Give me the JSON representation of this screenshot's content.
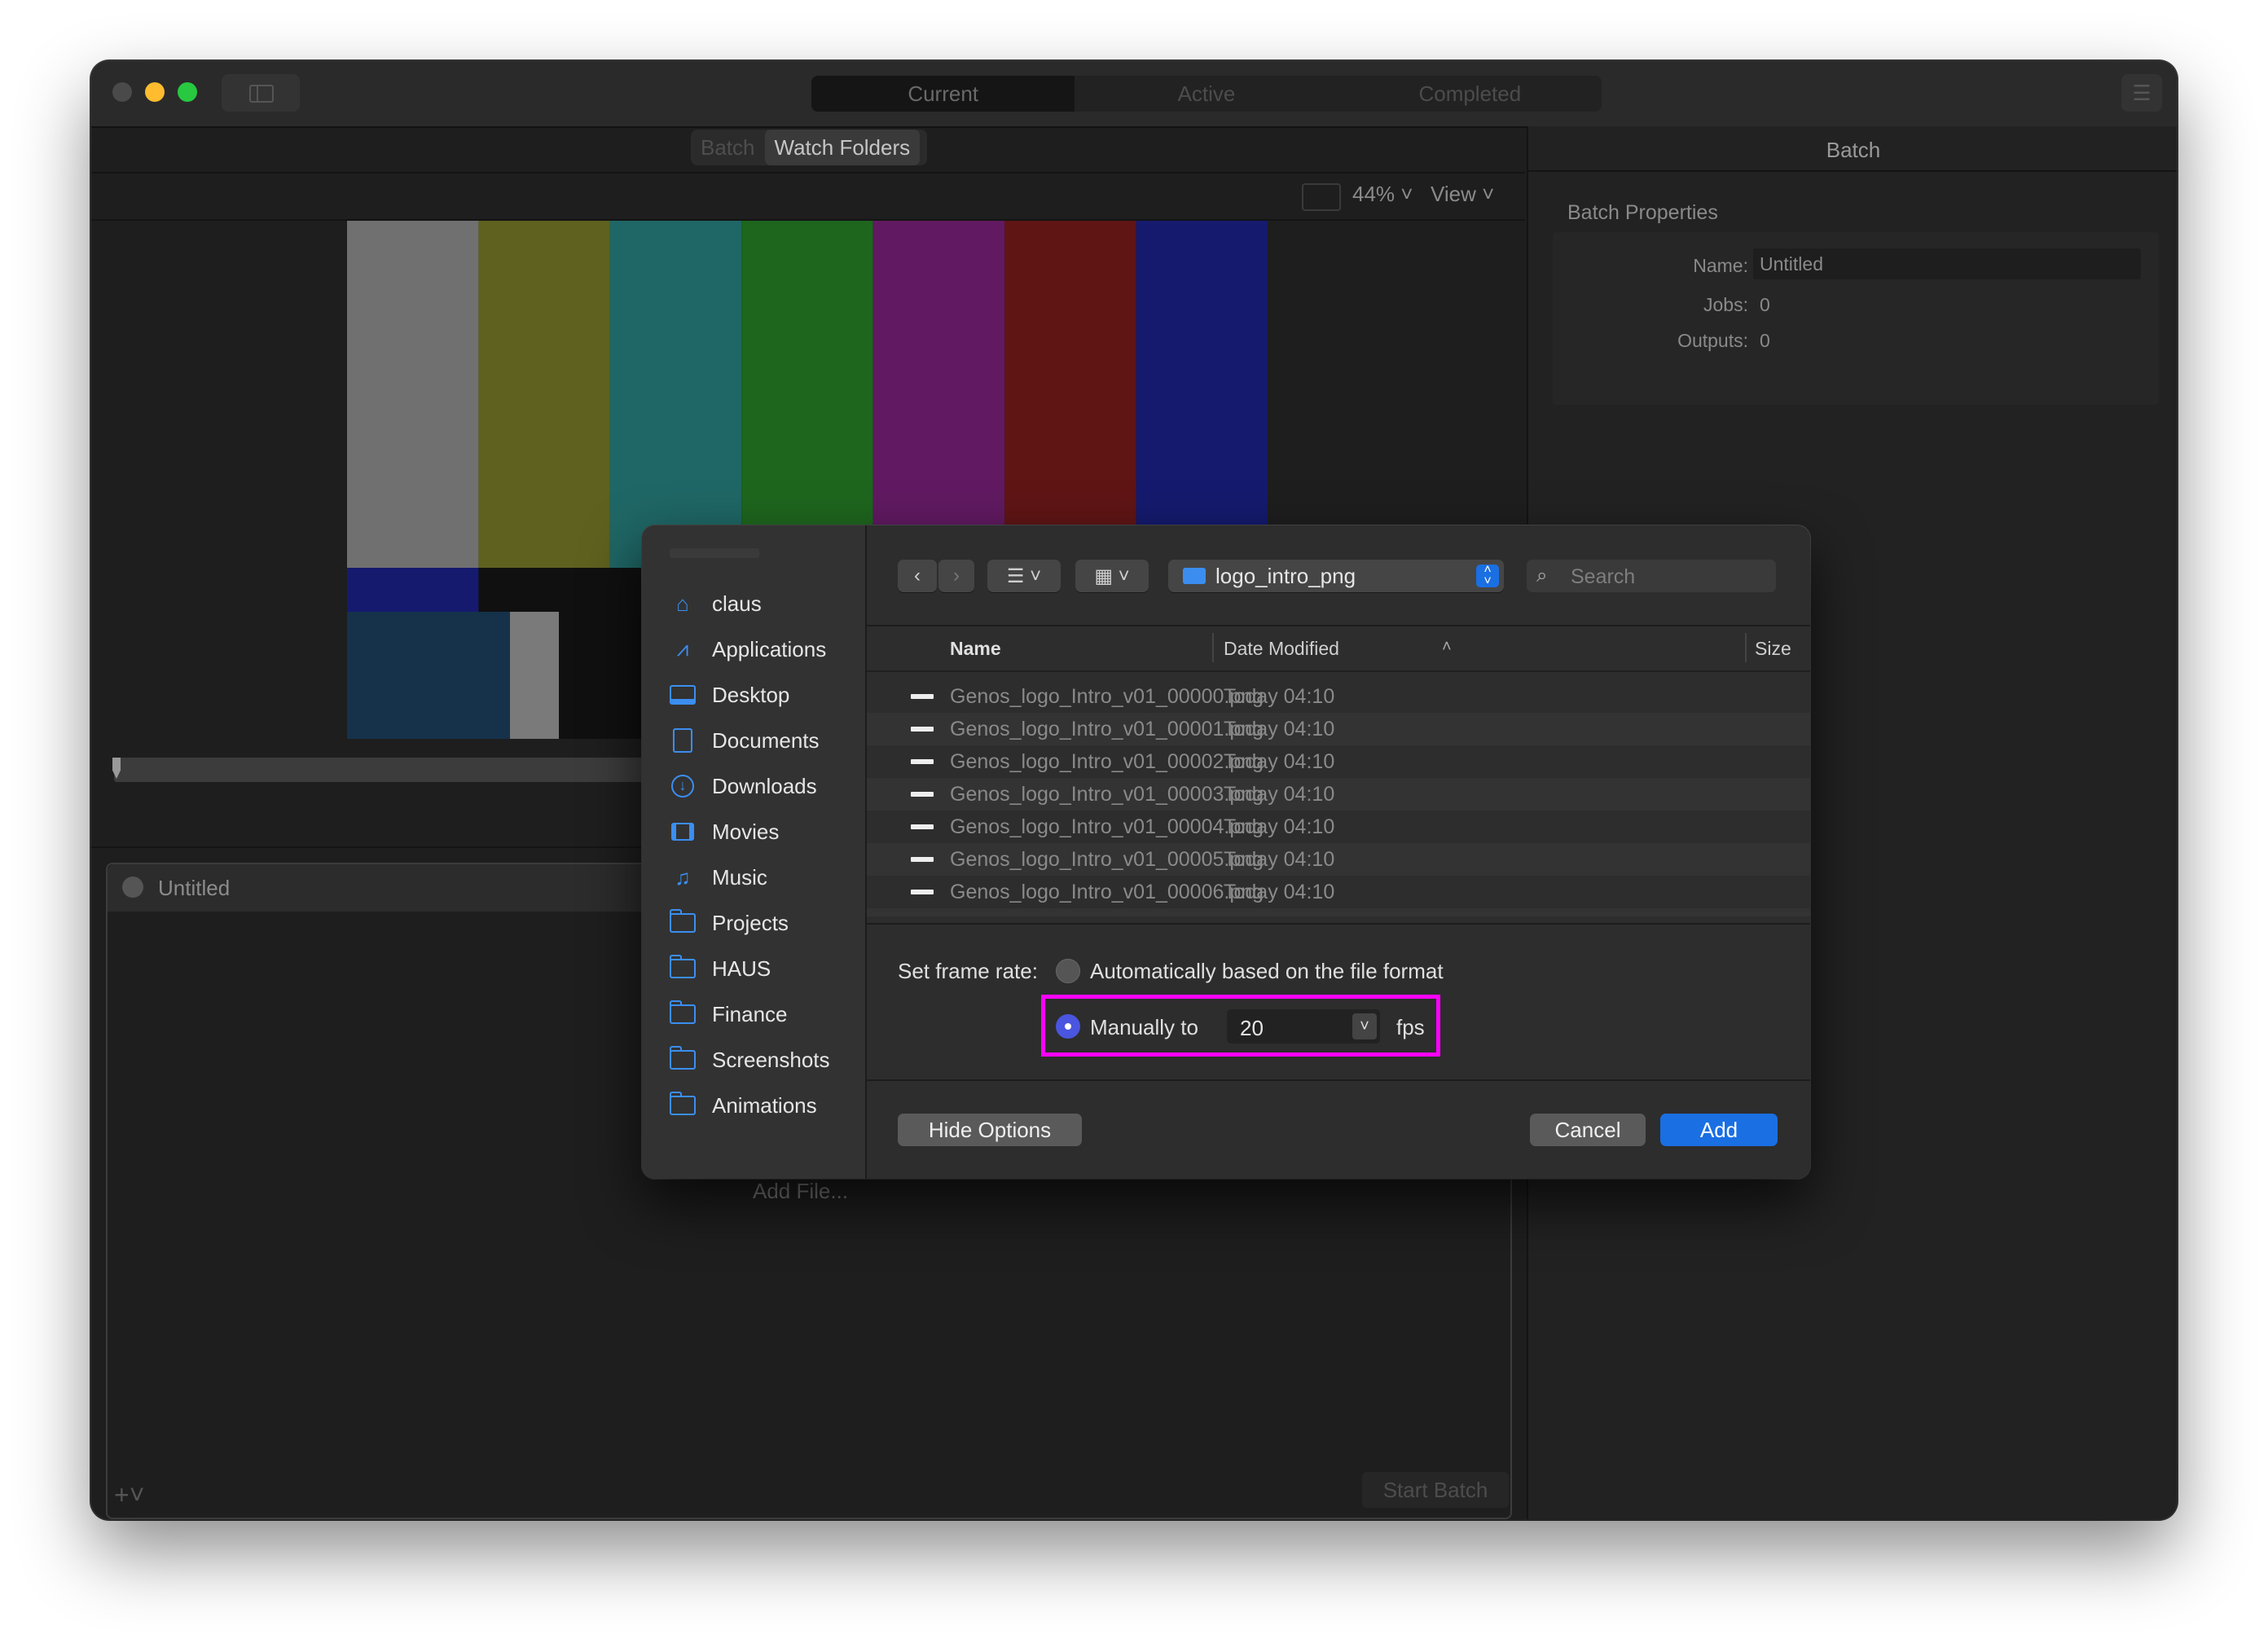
{
  "window": {
    "segments": [
      "Current",
      "Active",
      "Completed"
    ],
    "selected_segment": "Current",
    "subtabs": [
      "Batch",
      "Watch Folders"
    ],
    "selected_subtab": "Watch Folders",
    "zoom": "44%",
    "view_label": "View",
    "job_title": "Untitled",
    "add_file_label": "Add File...",
    "start_batch_label": "Start Batch"
  },
  "colors": {
    "close": "#ff5f57",
    "minimize": "#febc2e",
    "zoom": "#28c840",
    "accent": "#1a6fe3",
    "highlight_border": "#ff00ff",
    "colorbars": [
      "#707070",
      "#5f611f",
      "#1f6766",
      "#1e661e",
      "#611a61",
      "#601515",
      "#151a6e"
    ]
  },
  "inspector": {
    "header": "Batch",
    "section": "Batch Properties",
    "name_label": "Name:",
    "name_value": "Untitled",
    "jobs_label": "Jobs:",
    "jobs_value": "0",
    "outputs_label": "Outputs:",
    "outputs_value": "0"
  },
  "dialog": {
    "sidebar": [
      {
        "label": "claus",
        "icon": "home-icon"
      },
      {
        "label": "Applications",
        "icon": "applications-icon"
      },
      {
        "label": "Desktop",
        "icon": "desktop-icon"
      },
      {
        "label": "Documents",
        "icon": "document-icon"
      },
      {
        "label": "Downloads",
        "icon": "download-icon"
      },
      {
        "label": "Movies",
        "icon": "film-icon"
      },
      {
        "label": "Music",
        "icon": "music-note-icon"
      },
      {
        "label": "Projects",
        "icon": "folder-icon"
      },
      {
        "label": "HAUS",
        "icon": "folder-icon"
      },
      {
        "label": "Finance",
        "icon": "folder-icon"
      },
      {
        "label": "Screenshots",
        "icon": "folder-icon"
      },
      {
        "label": "Animations",
        "icon": "folder-icon"
      }
    ],
    "location": "logo_intro_png",
    "search_placeholder": "Search",
    "columns": {
      "name": "Name",
      "date": "Date Modified",
      "size": "Size"
    },
    "files": [
      {
        "name": "Genos_logo_Intro_v01_00000.png",
        "date": "Today 04:10"
      },
      {
        "name": "Genos_logo_Intro_v01_00001.png",
        "date": "Today 04:10"
      },
      {
        "name": "Genos_logo_Intro_v01_00002.png",
        "date": "Today 04:10"
      },
      {
        "name": "Genos_logo_Intro_v01_00003.png",
        "date": "Today 04:10"
      },
      {
        "name": "Genos_logo_Intro_v01_00004.png",
        "date": "Today 04:10"
      },
      {
        "name": "Genos_logo_Intro_v01_00005.png",
        "date": "Today 04:10"
      },
      {
        "name": "Genos_logo_Intro_v01_00006.png",
        "date": "Today 04:10"
      }
    ],
    "frame_rate_label": "Set frame rate:",
    "auto_option": "Automatically based on the file format",
    "manual_option": "Manually to",
    "fps_value": "20",
    "fps_unit": "fps",
    "hide_options": "Hide Options",
    "cancel": "Cancel",
    "add": "Add"
  }
}
